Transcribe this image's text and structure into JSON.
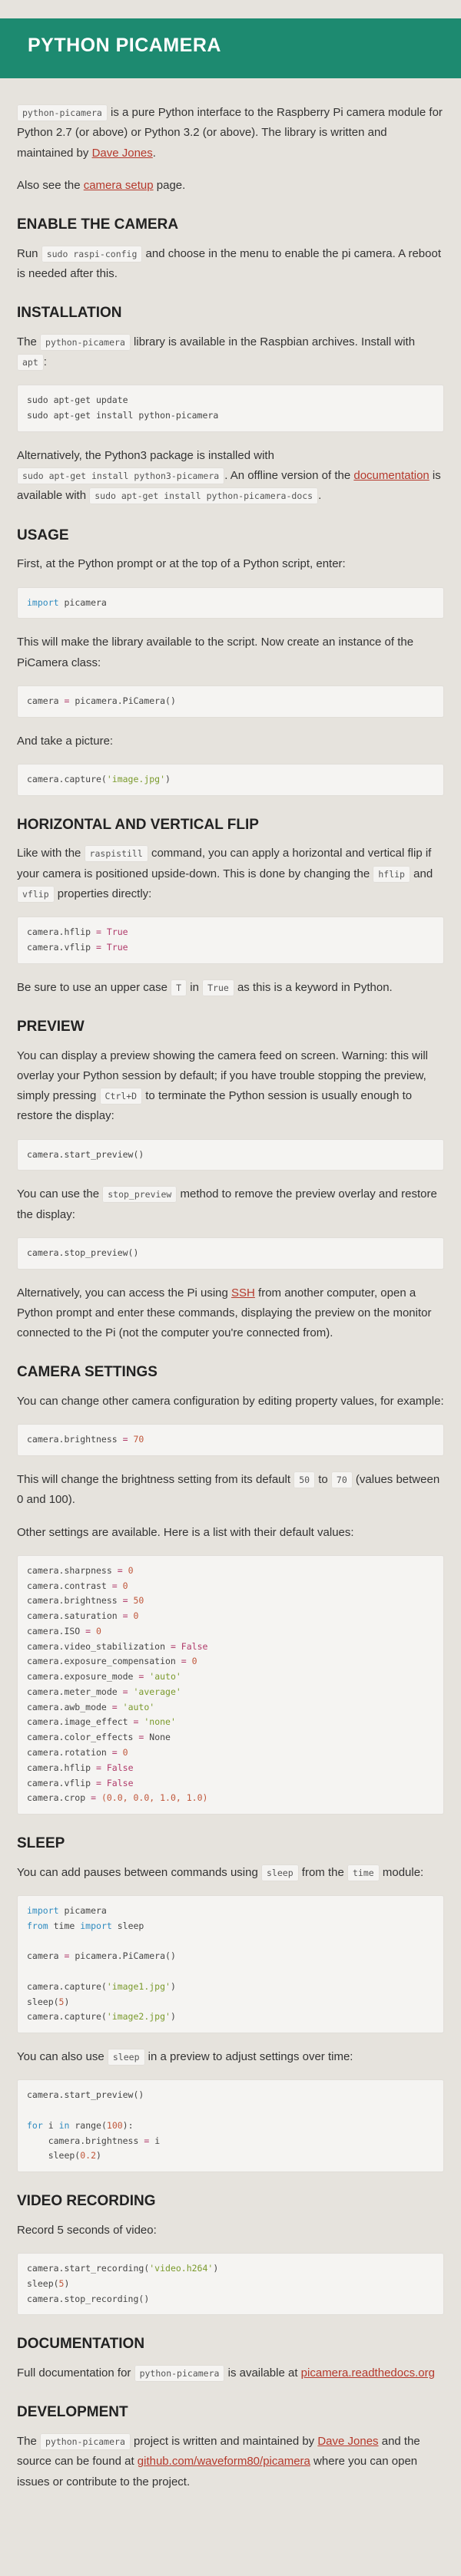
{
  "title": "PYTHON PICAMERA",
  "intro": {
    "p1_code": "python-picamera",
    "p1_text": " is a pure Python interface to the Raspberry Pi camera module for Python 2.7 (or above) or Python 3.2 (or above). The library is written and maintained by ",
    "p1_link": "Dave Jones",
    "p1_end": ".",
    "p2_a": "Also see the ",
    "p2_link": "camera setup",
    "p2_b": " page."
  },
  "enable": {
    "heading": "ENABLE THE CAMERA",
    "a": "Run ",
    "code": "sudo raspi-config",
    "b": " and choose in the menu to enable the pi camera. A reboot is needed after this."
  },
  "install": {
    "heading": "INSTALLATION",
    "a": "The ",
    "code1": "python-picamera",
    "b": " library is available in the Raspbian archives. Install with ",
    "code2": "apt",
    "c": ":",
    "pre": "sudo apt-get update\nsudo apt-get install python-picamera",
    "d": "Alternatively, the Python3 package is installed with ",
    "code3": "sudo apt-get install python3-picamera",
    "e": ". An offline version of the ",
    "link": "documentation",
    "f": " is available with ",
    "code4": "sudo apt-get install python-picamera-docs",
    "g": "."
  },
  "usage": {
    "heading": "USAGE",
    "p1": "First, at the Python prompt or at the top of a Python script, enter:",
    "code1_kw": "import",
    "code1_rest": " picamera",
    "p2": "This will make the library available to the script. Now create an instance of the PiCamera class:",
    "code2_a": "camera ",
    "code2_op": "=",
    "code2_b": " picamera.PiCamera()",
    "p3": "And take a picture:",
    "code3_a": "camera.capture(",
    "code3_str": "'image.jpg'",
    "code3_b": ")"
  },
  "flip": {
    "heading": "HORIZONTAL AND VERTICAL FLIP",
    "a": "Like with the ",
    "code1": "raspistill",
    "b": " command, you can apply a horizontal and vertical flip if your camera is positioned upside-down. This is done by changing the ",
    "code2": "hflip",
    "c": " and ",
    "code3": "vflip",
    "d": " properties directly:",
    "line1_a": "camera.hflip ",
    "line2_a": "camera.vflip ",
    "op": "=",
    "val": "True",
    "p2_a": "Be sure to use an upper case ",
    "p2_code1": "T",
    "p2_b": " in ",
    "p2_code2": "True",
    "p2_c": " as this is a keyword in Python."
  },
  "preview": {
    "heading": "PREVIEW",
    "p1_a": "You can display a preview showing the camera feed on screen. Warning: this will overlay your Python session by default; if you have trouble stopping the preview, simply pressing ",
    "p1_code": "Ctrl+D",
    "p1_b": " to terminate the Python session is usually enough to restore the display:",
    "code1": "camera.start_preview()",
    "p2_a": "You can use the ",
    "p2_code": "stop_preview",
    "p2_b": " method to remove the preview overlay and restore the display:",
    "code2": "camera.stop_preview()",
    "p3_a": "Alternatively, you can access the Pi using ",
    "p3_link": "SSH",
    "p3_b": " from another computer, open a Python prompt and enter these commands, displaying the preview on the monitor connected to the Pi (not the computer you're connected from)."
  },
  "settings": {
    "heading": "CAMERA SETTINGS",
    "p1": "You can change other camera configuration by editing property values, for example:",
    "code1_a": "camera.brightness ",
    "code1_val": "70",
    "p2_a": "This will change the brightness setting from its default ",
    "p2_code1": "50",
    "p2_b": " to ",
    "p2_code2": "70",
    "p2_c": " (values between 0 and 100).",
    "p3": "Other settings are available. Here is a list with their default values:",
    "list": [
      {
        "name": "camera.sharpness",
        "val": "0",
        "type": "num"
      },
      {
        "name": "camera.contrast",
        "val": "0",
        "type": "num"
      },
      {
        "name": "camera.brightness",
        "val": "50",
        "type": "num"
      },
      {
        "name": "camera.saturation",
        "val": "0",
        "type": "num"
      },
      {
        "name": "camera.ISO",
        "val": "0",
        "type": "num"
      },
      {
        "name": "camera.video_stabilization",
        "val": "False",
        "type": "op"
      },
      {
        "name": "camera.exposure_compensation",
        "val": "0",
        "type": "num"
      },
      {
        "name": "camera.exposure_mode",
        "val": "'auto'",
        "type": "str"
      },
      {
        "name": "camera.meter_mode",
        "val": "'average'",
        "type": "str"
      },
      {
        "name": "camera.awb_mode",
        "val": "'auto'",
        "type": "str"
      },
      {
        "name": "camera.image_effect",
        "val": "'none'",
        "type": "str"
      },
      {
        "name": "camera.color_effects",
        "val": "None",
        "type": "plain"
      },
      {
        "name": "camera.rotation",
        "val": "0",
        "type": "num"
      },
      {
        "name": "camera.hflip",
        "val": "False",
        "type": "op"
      },
      {
        "name": "camera.vflip",
        "val": "False",
        "type": "op"
      },
      {
        "name": "camera.crop",
        "val": "(0.0, 0.0, 1.0, 1.0)",
        "type": "num"
      }
    ]
  },
  "sleep": {
    "heading": "SLEEP",
    "p1_a": "You can add pauses between commands using ",
    "p1_code1": "sleep",
    "p1_b": " from the ",
    "p1_code2": "time",
    "p1_c": " module:",
    "imp1_kw": "import",
    "imp1_rest": " picamera",
    "imp2_kw": "from",
    "imp2_mid": " time ",
    "imp2_kw2": "import",
    "imp2_rest": " sleep",
    "cam_a": "camera ",
    "cam_b": " picamera.PiCamera()",
    "cap1_a": "camera.capture(",
    "cap1_str": "'image1.jpg'",
    "cap_end": ")",
    "sleep_a": "sleep(",
    "sleep_val": "5",
    "sleep_end": ")",
    "cap2_str": "'image2.jpg'",
    "p2_a": "You can also use ",
    "p2_code": "sleep",
    "p2_b": " in a preview to adjust settings over time:",
    "loop_start": "camera.start_preview()",
    "loop_for": "for",
    "loop_i": " i ",
    "loop_in": "in",
    "loop_range": " range(",
    "loop_num": "100",
    "loop_end": "):",
    "loop_body1_a": "    camera.brightness ",
    "loop_body1_b": " i",
    "loop_body2_a": "    sleep(",
    "loop_body2_val": "0.2",
    "loop_body2_end": ")"
  },
  "video": {
    "heading": "VIDEO RECORDING",
    "p1": "Record 5 seconds of video:",
    "l1_a": "camera.start_recording(",
    "l1_str": "'video.h264'",
    "l1_end": ")",
    "l2_a": "sleep(",
    "l2_val": "5",
    "l2_end": ")",
    "l3": "camera.stop_recording()"
  },
  "docs": {
    "heading": "DOCUMENTATION",
    "a": "Full documentation for ",
    "code": "python-picamera",
    "b": " is available at ",
    "link": "picamera.readthedocs.org"
  },
  "dev": {
    "heading": "DEVELOPMENT",
    "a": "The ",
    "code": "python-picamera",
    "b": " project is written and maintained by ",
    "link1": "Dave Jones",
    "c": " and the source can be found at ",
    "link2": "github.com/waveform80/picamera",
    "d": " where you can open issues or contribute to the project."
  }
}
